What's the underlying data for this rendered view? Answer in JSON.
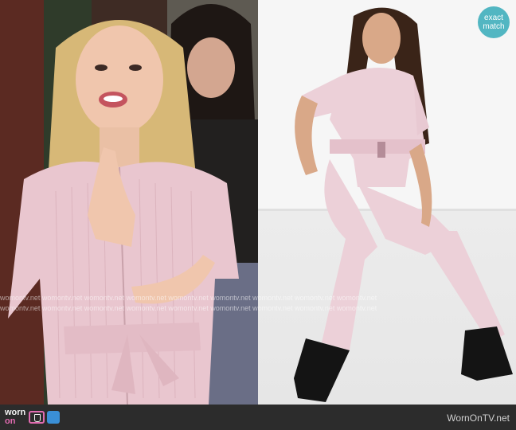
{
  "exact_match_badge": {
    "line1": "exact",
    "line2": "match"
  },
  "logo": {
    "part1": "worn",
    "part2": "on"
  },
  "footer": {
    "site_url": "WornOnTV.net"
  },
  "watermark": {
    "row1": "womontv.net womontv.net womontv.net womontv.net womontv.net womontv.net womontv.net womontv.net womontv.net",
    "row2": "womontv.net womontv.net womontv.net womontv.net womontv.net womontv.net womontv.net womontv.net womontv.net"
  },
  "colors": {
    "badge": "#52b6c2",
    "footer": "#2c2c2c",
    "jumpsuit_pink": "#e9c6cf",
    "logo_accent": "#e06bb0"
  },
  "icons": [
    "tv-icon",
    "tv-icon-blue"
  ]
}
